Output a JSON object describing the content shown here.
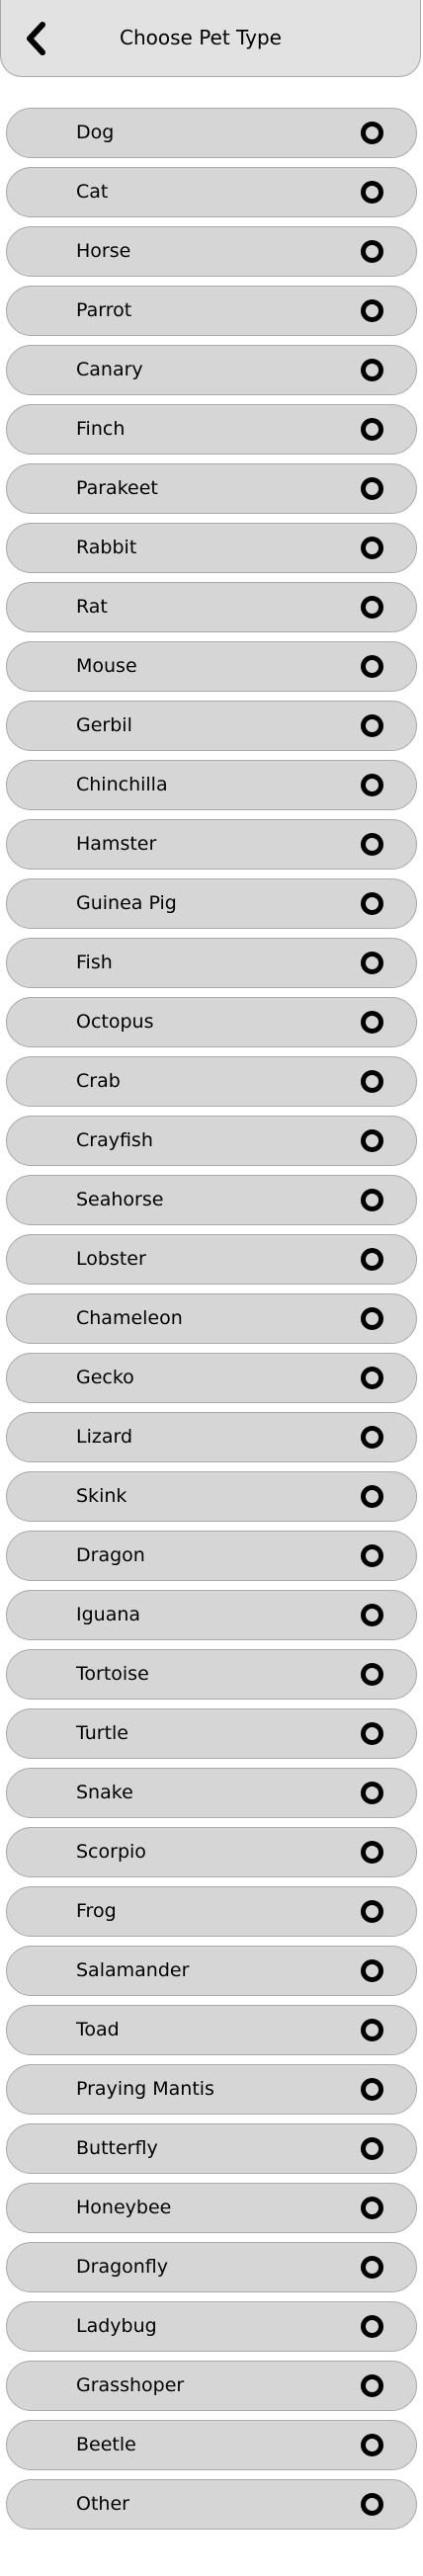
{
  "header": {
    "title": "Choose Pet Type",
    "back_icon": "chevron-left-icon"
  },
  "pets": [
    {
      "label": "Dog",
      "selected": false
    },
    {
      "label": "Cat",
      "selected": false
    },
    {
      "label": "Horse",
      "selected": false
    },
    {
      "label": "Parrot",
      "selected": false
    },
    {
      "label": "Canary",
      "selected": false
    },
    {
      "label": "Finch",
      "selected": false
    },
    {
      "label": "Parakeet",
      "selected": false
    },
    {
      "label": "Rabbit",
      "selected": false
    },
    {
      "label": "Rat",
      "selected": false
    },
    {
      "label": "Mouse",
      "selected": false
    },
    {
      "label": "Gerbil",
      "selected": false
    },
    {
      "label": "Chinchilla",
      "selected": false
    },
    {
      "label": "Hamster",
      "selected": false
    },
    {
      "label": "Guinea Pig",
      "selected": false
    },
    {
      "label": "Fish",
      "selected": false
    },
    {
      "label": "Octopus",
      "selected": false
    },
    {
      "label": "Crab",
      "selected": false
    },
    {
      "label": "Crayfish",
      "selected": false
    },
    {
      "label": "Seahorse",
      "selected": false
    },
    {
      "label": "Lobster",
      "selected": false
    },
    {
      "label": "Chameleon",
      "selected": false
    },
    {
      "label": "Gecko",
      "selected": false
    },
    {
      "label": "Lizard",
      "selected": false
    },
    {
      "label": "Skink",
      "selected": false
    },
    {
      "label": "Dragon",
      "selected": false
    },
    {
      "label": "Iguana",
      "selected": false
    },
    {
      "label": "Tortoise",
      "selected": false
    },
    {
      "label": "Turtle",
      "selected": false
    },
    {
      "label": "Snake",
      "selected": false
    },
    {
      "label": "Scorpio",
      "selected": false
    },
    {
      "label": "Frog",
      "selected": false
    },
    {
      "label": "Salamander",
      "selected": false
    },
    {
      "label": "Toad",
      "selected": false
    },
    {
      "label": "Praying Mantis",
      "selected": false
    },
    {
      "label": "Butterfly",
      "selected": false
    },
    {
      "label": "Honeybee",
      "selected": false
    },
    {
      "label": "Dragonfly",
      "selected": false
    },
    {
      "label": "Ladybug",
      "selected": false
    },
    {
      "label": "Grasshoper",
      "selected": false
    },
    {
      "label": "Beetle",
      "selected": false
    },
    {
      "label": "Other",
      "selected": false
    }
  ],
  "colors": {
    "header_bg": "#e2e2e2",
    "row_bg": "#d6d6d6",
    "border": "#a9a9a9",
    "radio": "#000000"
  }
}
